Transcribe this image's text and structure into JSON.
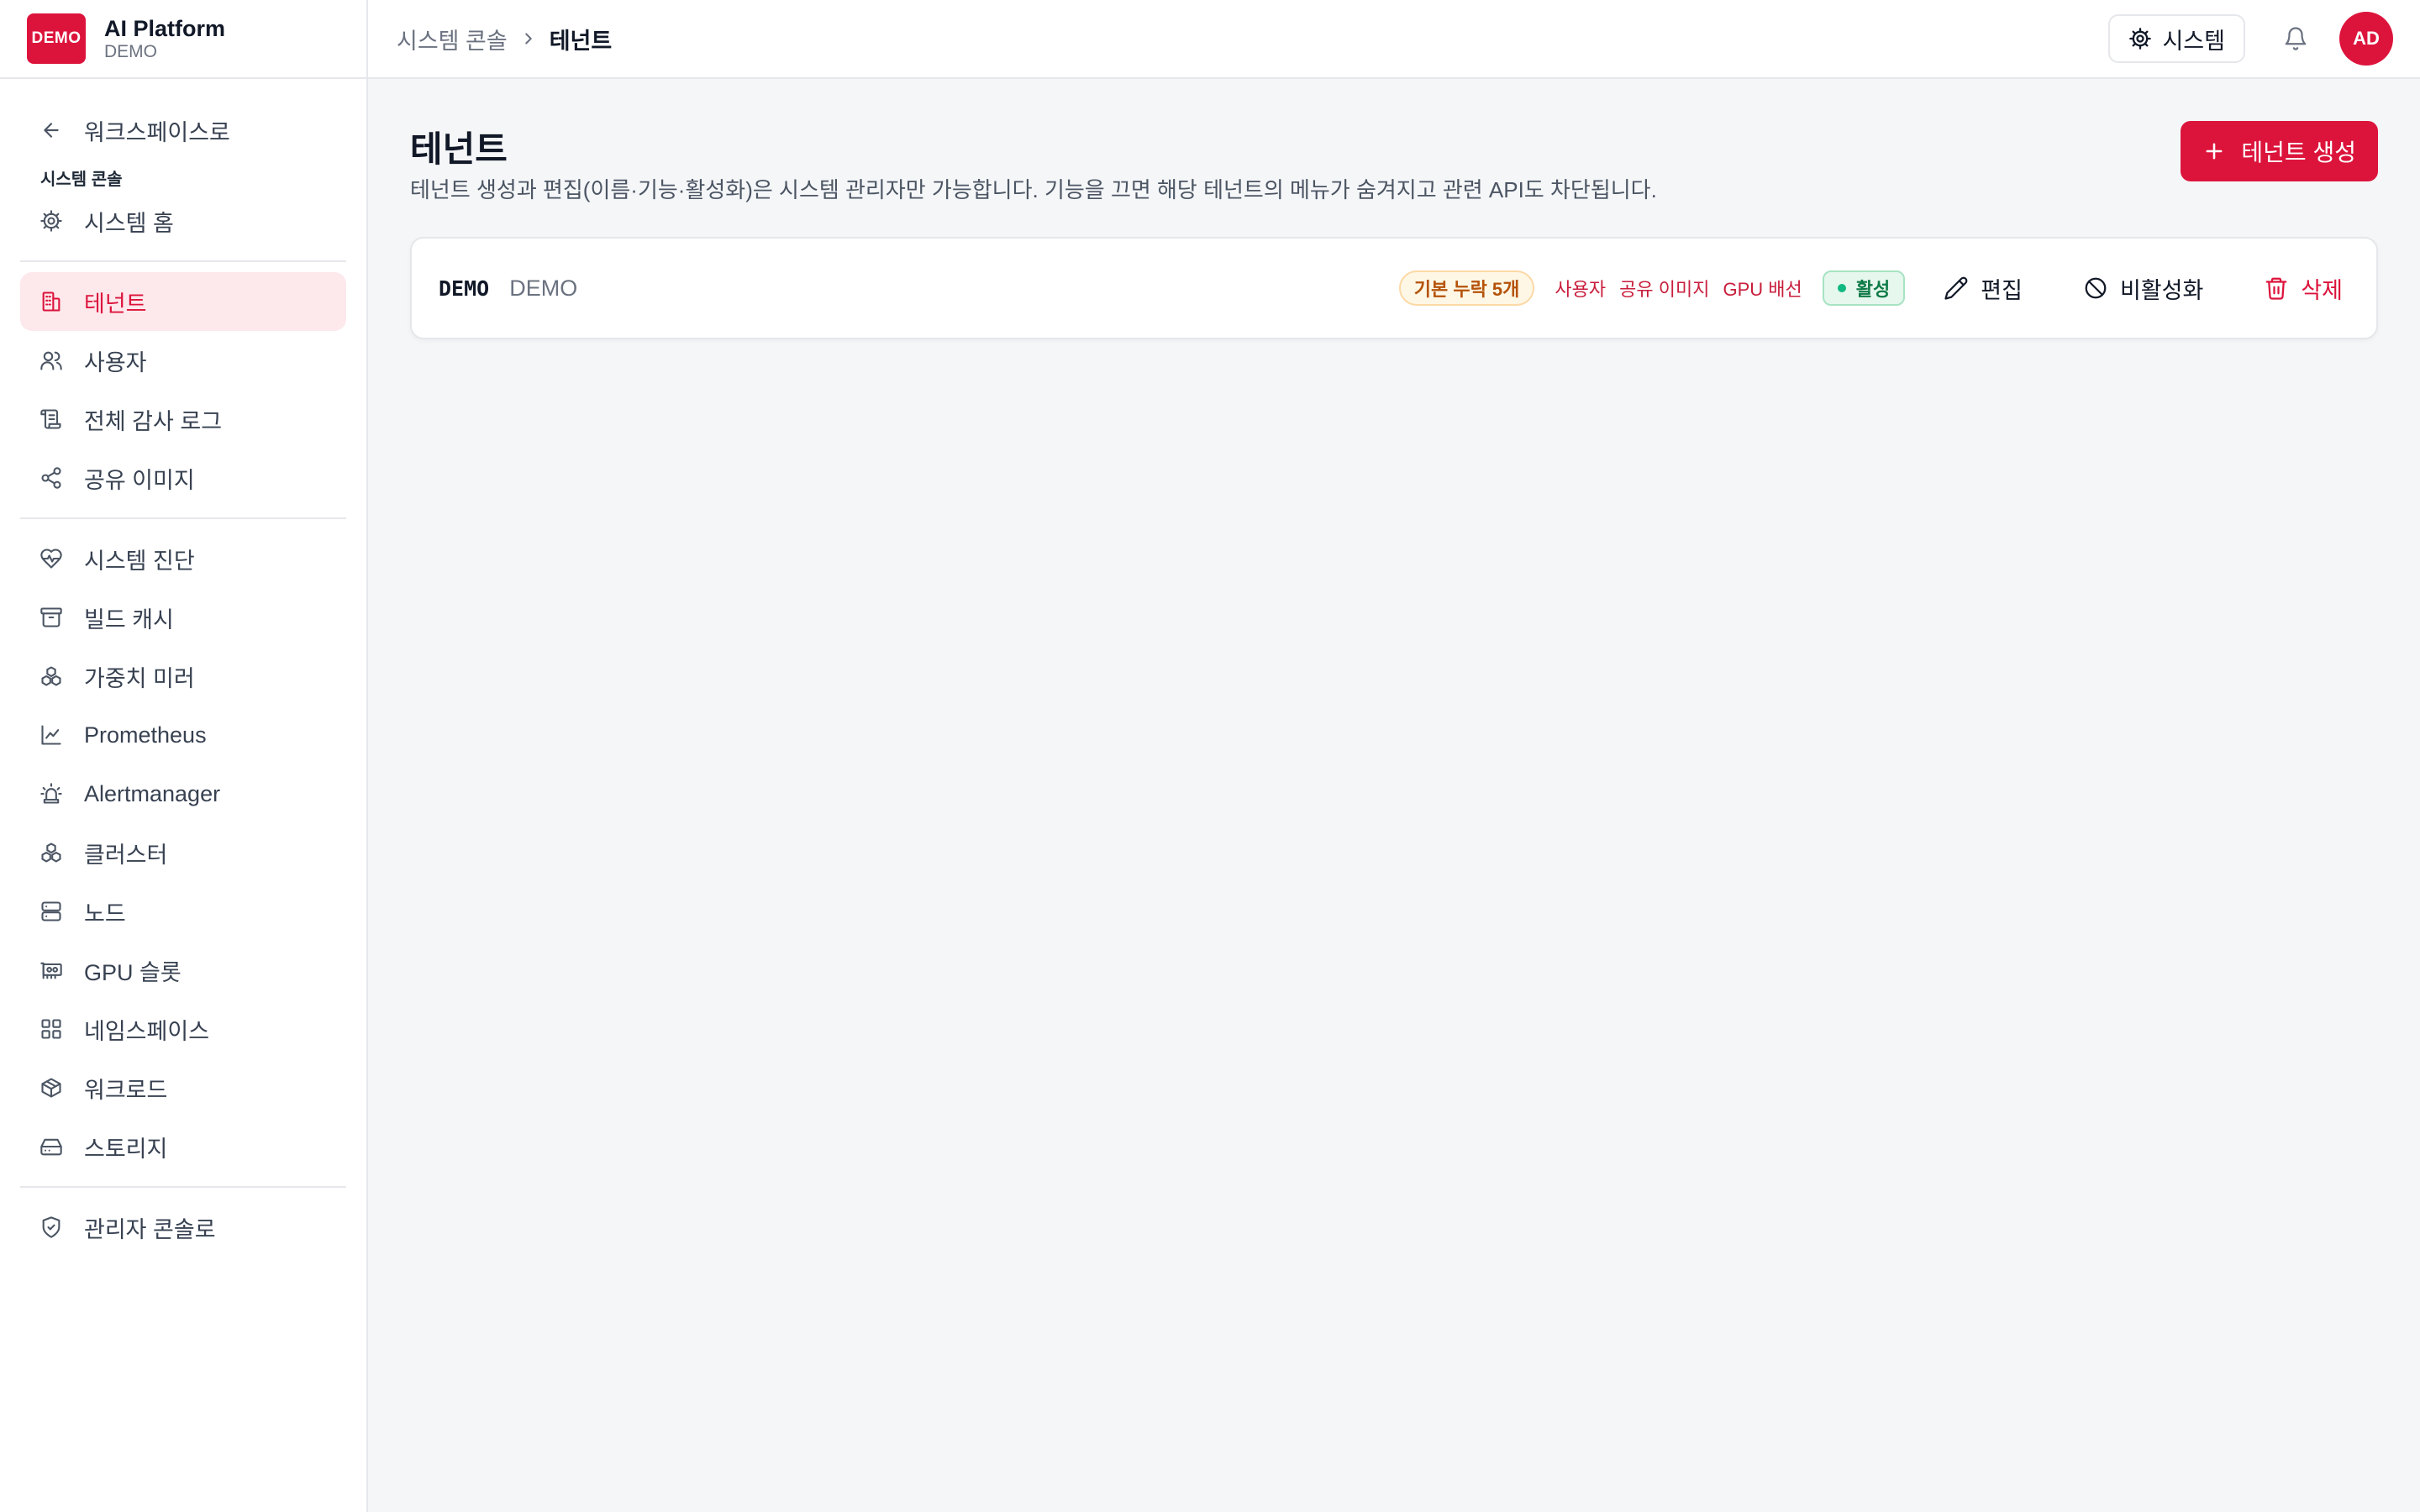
{
  "brand": {
    "logo_text": "DEMO",
    "title": "AI Platform",
    "subtitle": "DEMO",
    "accent": "#dc143c"
  },
  "sidebar": {
    "back_label": "워크스페이스로",
    "section_label": "시스템 콘솔",
    "home_label": "시스템 홈",
    "group1": [
      {
        "label": "테넌트",
        "icon": "building-icon",
        "active": true
      },
      {
        "label": "사용자",
        "icon": "users-icon"
      },
      {
        "label": "전체 감사 로그",
        "icon": "scroll-icon"
      },
      {
        "label": "공유 이미지",
        "icon": "share-icon"
      }
    ],
    "group2": [
      {
        "label": "시스템 진단",
        "icon": "heart-pulse-icon"
      },
      {
        "label": "빌드 캐시",
        "icon": "archive-icon"
      },
      {
        "label": "가중치 미러",
        "icon": "boxes-icon"
      },
      {
        "label": "Prometheus",
        "icon": "line-chart-icon"
      },
      {
        "label": "Alertmanager",
        "icon": "siren-icon"
      },
      {
        "label": "클러스터",
        "icon": "cluster-icon"
      },
      {
        "label": "노드",
        "icon": "server-icon"
      },
      {
        "label": "GPU 슬롯",
        "icon": "gpu-icon"
      },
      {
        "label": "네임스페이스",
        "icon": "grid-icon"
      },
      {
        "label": "워크로드",
        "icon": "package-icon"
      },
      {
        "label": "스토리지",
        "icon": "hard-drive-icon"
      }
    ],
    "admin_label": "관리자 콘솔로"
  },
  "topbar": {
    "breadcrumb_parent": "시스템 콘솔",
    "breadcrumb_current": "테넌트",
    "system_button": "시스템",
    "avatar": "AD"
  },
  "main": {
    "title": "테넌트",
    "description": "테넌트 생성과 편집(이름·기능·활성화)은 시스템 관리자만 가능합니다. 기능을 끄면 해당 테넌트의 메뉴가 숨겨지고 관련 API도 차단됩니다.",
    "create_button": "테넌트 생성"
  },
  "tenant": {
    "code": "DEMO",
    "name": "DEMO",
    "missing_badge": "기본 누락 5개",
    "features": [
      "사용자",
      "공유 이미지",
      "GPU 배선"
    ],
    "status": "활성",
    "edit_label": "편집",
    "disable_label": "비활성화",
    "delete_label": "삭제"
  }
}
